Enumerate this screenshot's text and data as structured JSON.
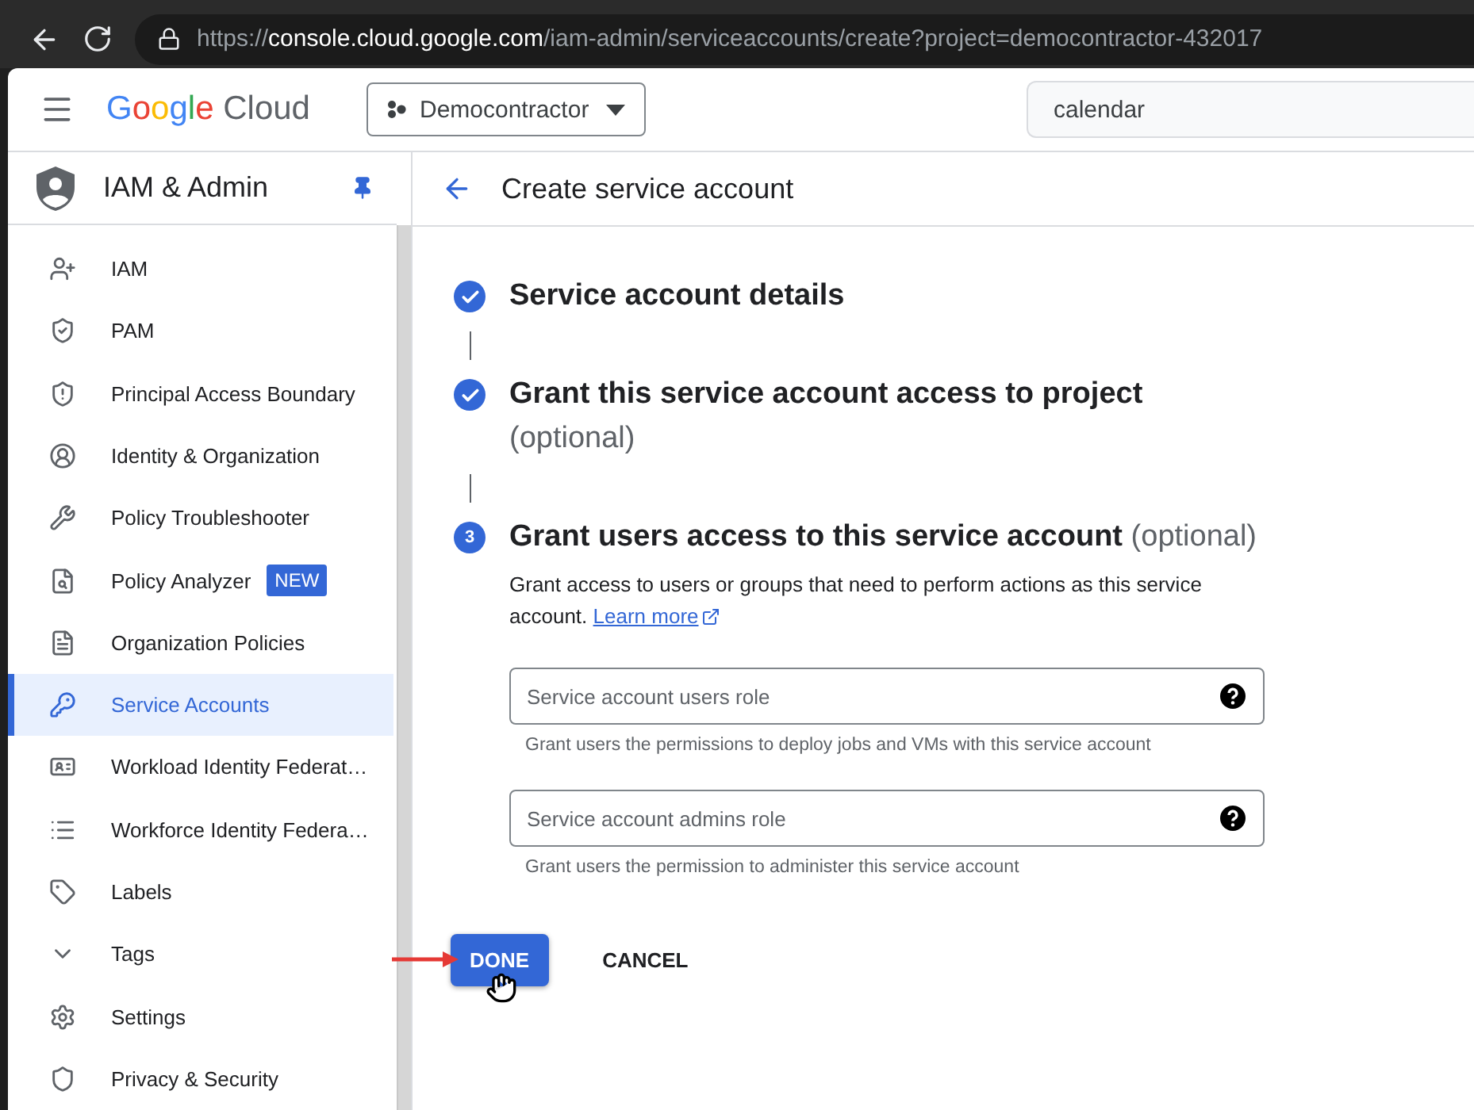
{
  "browser": {
    "url": {
      "scheme": "https://",
      "host": "console.cloud.google.com",
      "path": "/iam-admin/serviceaccounts/create?project=democontractor-432017"
    }
  },
  "header": {
    "logo": {
      "brand": "Google",
      "product": "Cloud"
    },
    "project": "Democontractor",
    "search": {
      "value": "calendar"
    }
  },
  "sidebar": {
    "title": "IAM & Admin",
    "items": [
      {
        "label": "IAM",
        "selected": false
      },
      {
        "label": "PAM",
        "selected": false
      },
      {
        "label": "Principal Access Boundary",
        "selected": false
      },
      {
        "label": "Identity & Organization",
        "selected": false
      },
      {
        "label": "Policy Troubleshooter",
        "selected": false
      },
      {
        "label": "Policy Analyzer",
        "selected": false,
        "badge": "NEW"
      },
      {
        "label": "Organization Policies",
        "selected": false
      },
      {
        "label": "Service Accounts",
        "selected": true
      },
      {
        "label": "Workload Identity Federat…",
        "selected": false
      },
      {
        "label": "Workforce Identity Federa…",
        "selected": false
      },
      {
        "label": "Labels",
        "selected": false
      },
      {
        "label": "Tags",
        "selected": false
      },
      {
        "label": "Settings",
        "selected": false
      },
      {
        "label": "Privacy & Security",
        "selected": false
      }
    ]
  },
  "page": {
    "title": "Create service account",
    "steps": [
      {
        "done": true,
        "title": "Service account details"
      },
      {
        "done": true,
        "title": "Grant this service account access to project",
        "optional": "(optional)"
      },
      {
        "done": false,
        "number": "3",
        "title": "Grant users access to this service account",
        "optional": "(optional)",
        "description": "Grant access to users or groups that need to perform actions as this service account.",
        "link": "Learn more",
        "fields": [
          {
            "placeholder": "Service account users role",
            "hint": "Grant users the permissions to deploy jobs and VMs with this service account"
          },
          {
            "placeholder": "Service account admins role",
            "hint": "Grant users the permission to administer this service account"
          }
        ]
      }
    ],
    "buttons": [
      {
        "label": "DONE",
        "kind": "primary"
      },
      {
        "label": "CANCEL",
        "kind": "text"
      }
    ]
  }
}
